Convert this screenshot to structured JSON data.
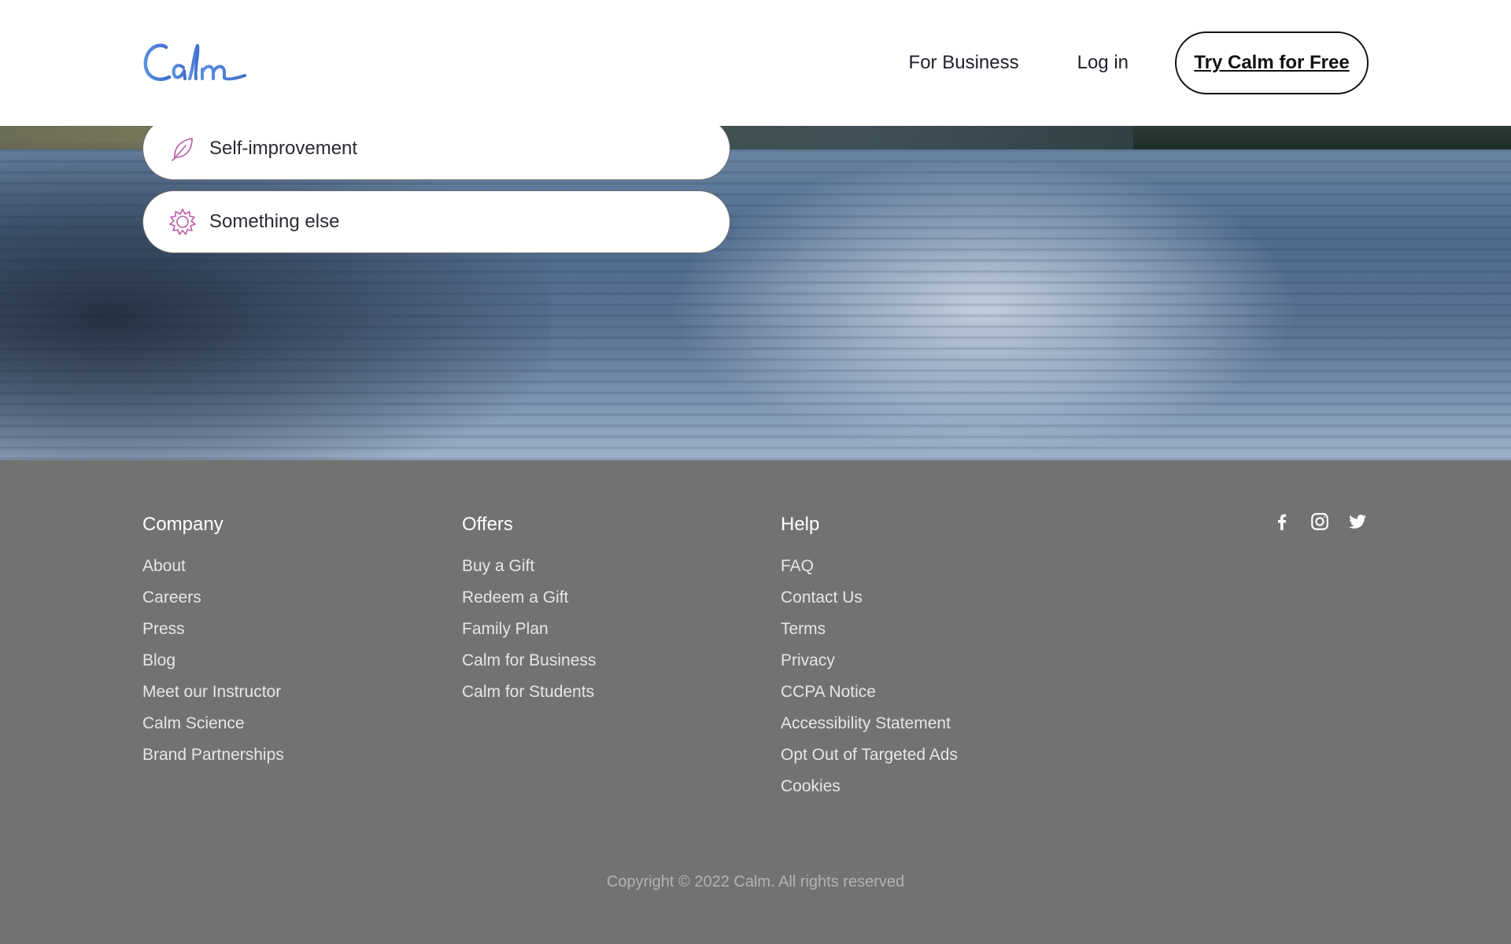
{
  "brand": {
    "logo_text": "Calm",
    "accent": "#4a7fd6"
  },
  "header": {
    "nav": [
      {
        "label": "For Business"
      },
      {
        "label": "Log in"
      }
    ],
    "cta_label": "Try Calm for Free"
  },
  "options": [
    {
      "label": "Self-improvement",
      "icon": "leaf-icon",
      "icon_color": "#b85ba8"
    },
    {
      "label": "Something else",
      "icon": "sun-icon",
      "icon_color": "#b85ba8"
    }
  ],
  "footer": {
    "columns": [
      {
        "title": "Company",
        "links": [
          "About",
          "Careers",
          "Press",
          "Blog",
          "Meet our Instructor",
          "Calm Science",
          "Brand Partnerships"
        ]
      },
      {
        "title": "Offers",
        "links": [
          "Buy a Gift",
          "Redeem a Gift",
          "Family Plan",
          "Calm for Business",
          "Calm for Students"
        ]
      },
      {
        "title": "Help",
        "links": [
          "FAQ",
          "Contact Us",
          "Terms",
          "Privacy",
          "CCPA Notice",
          "Accessibility Statement",
          "Opt Out of Targeted Ads",
          "Cookies"
        ]
      }
    ],
    "social": [
      "facebook-icon",
      "instagram-icon",
      "twitter-icon"
    ],
    "copyright": "Copyright © 2022 Calm. All rights reserved"
  }
}
